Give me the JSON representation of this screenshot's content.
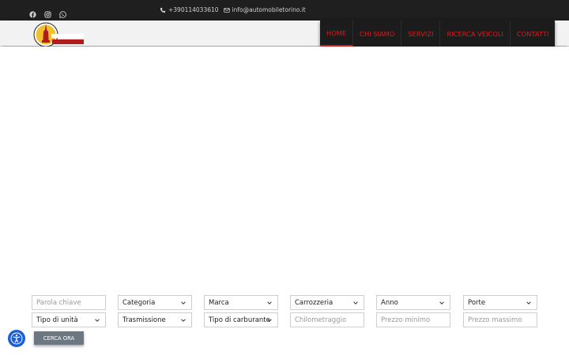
{
  "topbar": {
    "phone": "+390114033610",
    "email": "info@automobiletorino.it",
    "social": [
      "facebook-icon",
      "instagram-icon",
      "whatsapp-icon"
    ],
    "background": "#1f1f1f"
  },
  "logo": {
    "line1": "AUTOMOBILE",
    "line2": "TORINO"
  },
  "nav": {
    "items": [
      {
        "label": "HOME",
        "active": true
      },
      {
        "label": "CHI SIAMO",
        "active": false
      },
      {
        "label": "SERVIZI",
        "active": false
      },
      {
        "label": "RICERCA VEICOLI",
        "active": false
      },
      {
        "label": "CONTATTI",
        "active": false
      }
    ],
    "accent": "#d51e1e"
  },
  "search": {
    "keyword_placeholder": "Parola chiave",
    "category": "Categoria",
    "brand": "Marca",
    "body": "Carrozzeria",
    "year": "Anno",
    "doors": "Porte",
    "unit_type": "Tipo di unità",
    "transmission": "Trasmissione",
    "fuel": "Tipo di carburante",
    "mileage_placeholder": "Chilometraggio",
    "min_price_placeholder": "Prezzo minimo",
    "max_price_placeholder": "Prezzo massimo",
    "button_label": "CERCA ORA"
  }
}
